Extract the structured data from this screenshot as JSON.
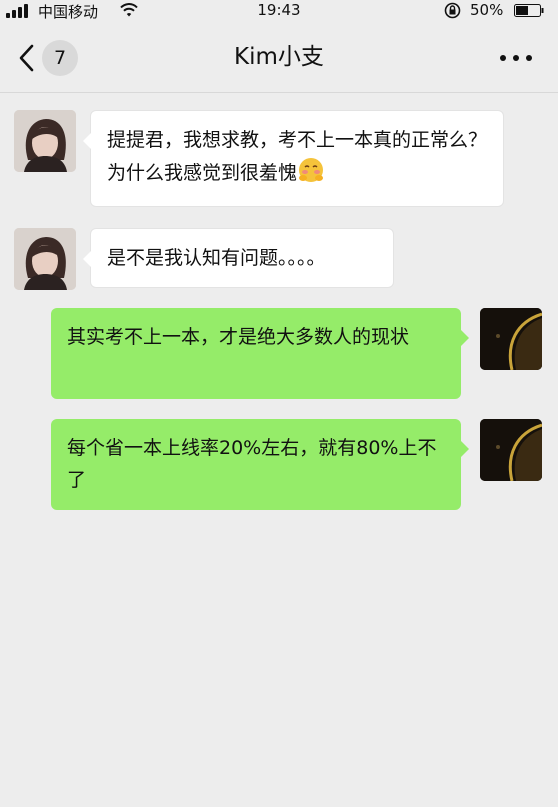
{
  "status_bar": {
    "carrier": "中国移动",
    "time": "19:43",
    "battery": "50%"
  },
  "nav": {
    "unread_count": "7",
    "title": "Kim小支"
  },
  "messages": [
    {
      "sender": "friend",
      "text": "提提君，我想求教，考不上一本真的正常么？为什么我感觉到很羞愧",
      "emoji": "embarrassed-face-emoji"
    },
    {
      "sender": "friend",
      "text": "是不是我认知有问题。。。。"
    },
    {
      "sender": "self",
      "text": "其实考不上一本，才是绝大多数人的现状"
    },
    {
      "sender": "self",
      "text": "每个省一本上线率20%左右，就有80%上不了"
    }
  ],
  "colors": {
    "background": "#ededed",
    "self_bubble": "#95ec69",
    "friend_bubble": "#ffffff"
  }
}
